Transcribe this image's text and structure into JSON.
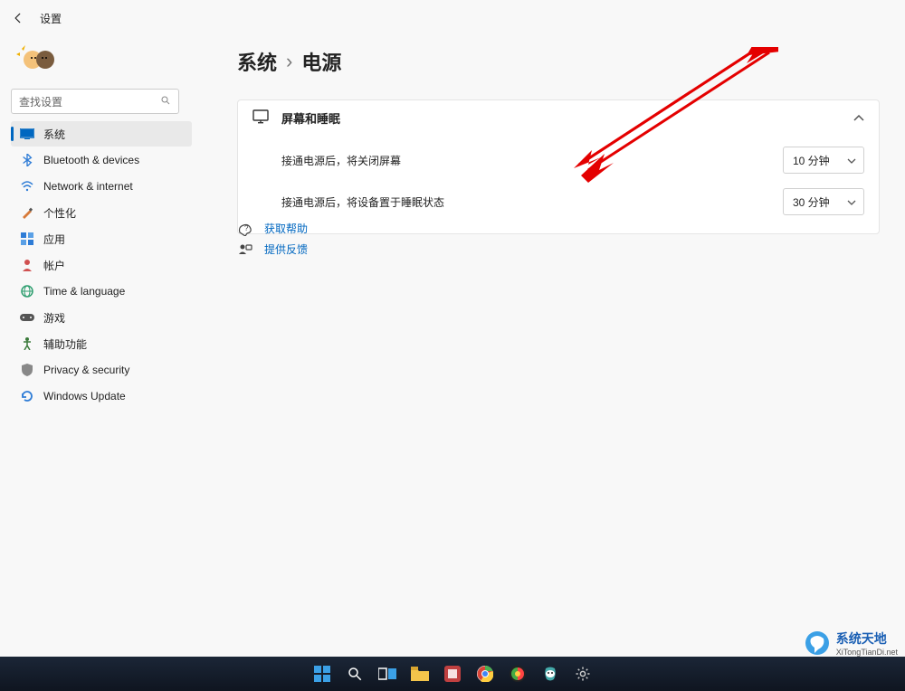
{
  "colors": {
    "accent": "#0067c0",
    "link": "#0067c0"
  },
  "header": {
    "title": "设置"
  },
  "search": {
    "placeholder": "查找设置"
  },
  "sidebar": {
    "items": [
      {
        "label": "系统"
      },
      {
        "label": "Bluetooth & devices"
      },
      {
        "label": "Network & internet"
      },
      {
        "label": "个性化"
      },
      {
        "label": "应用"
      },
      {
        "label": "帐户"
      },
      {
        "label": "Time & language"
      },
      {
        "label": "游戏"
      },
      {
        "label": "辅助功能"
      },
      {
        "label": "Privacy & security"
      },
      {
        "label": "Windows Update"
      }
    ],
    "active_index": 0
  },
  "breadcrumb": {
    "root": "系统",
    "leaf": "电源"
  },
  "card": {
    "title": "屏幕和睡眠",
    "rows": [
      {
        "label": "接通电源后，将关闭屏幕",
        "value": "10 分钟"
      },
      {
        "label": "接通电源后，将设备置于睡眠状态",
        "value": "30 分钟"
      }
    ]
  },
  "links": {
    "help": "获取帮助",
    "feedback": "提供反馈"
  },
  "watermark": {
    "title": "系统天地",
    "sub": "XiTongTianDi.net"
  }
}
